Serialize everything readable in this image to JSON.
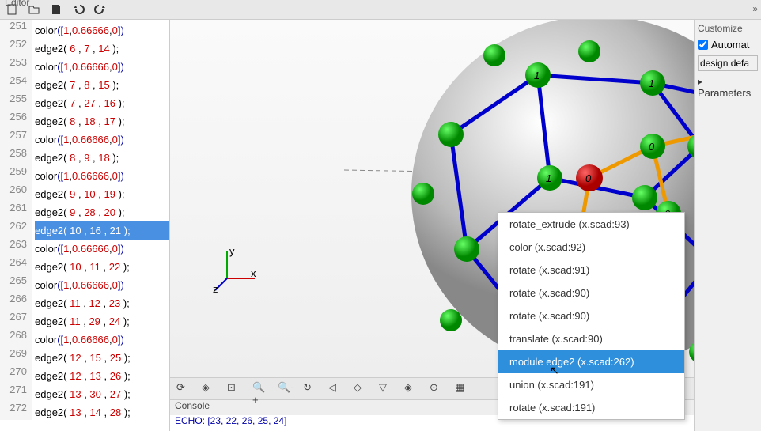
{
  "editor_label": "Editor",
  "toolbar_icons": [
    "new-icon",
    "open-icon",
    "save-icon",
    "undo-icon",
    "redo-icon"
  ],
  "code_lines": [
    {
      "n": "251",
      "sel": false,
      "parts": [
        {
          "t": "color",
          "c": "fn"
        },
        {
          "t": "([",
          "c": "brk"
        },
        {
          "t": "1",
          "c": "num"
        },
        {
          "t": ",",
          "c": ""
        },
        {
          "t": "0.66666",
          "c": "num"
        },
        {
          "t": ",",
          "c": ""
        },
        {
          "t": "0",
          "c": "num"
        },
        {
          "t": "])",
          "c": "brk"
        }
      ]
    },
    {
      "n": "252",
      "sel": false,
      "parts": [
        {
          "t": "edge2",
          "c": "fn"
        },
        {
          "t": "( ",
          "c": ""
        },
        {
          "t": "6",
          "c": "num"
        },
        {
          "t": " , ",
          "c": ""
        },
        {
          "t": "7",
          "c": "num"
        },
        {
          "t": " , ",
          "c": ""
        },
        {
          "t": "14",
          "c": "num"
        },
        {
          "t": " );",
          "c": ""
        }
      ]
    },
    {
      "n": "253",
      "sel": false,
      "parts": [
        {
          "t": "color",
          "c": "fn"
        },
        {
          "t": "([",
          "c": "brk"
        },
        {
          "t": "1",
          "c": "num"
        },
        {
          "t": ",",
          "c": ""
        },
        {
          "t": "0.66666",
          "c": "num"
        },
        {
          "t": ",",
          "c": ""
        },
        {
          "t": "0",
          "c": "num"
        },
        {
          "t": "])",
          "c": "brk"
        }
      ]
    },
    {
      "n": "254",
      "sel": false,
      "parts": [
        {
          "t": "edge2",
          "c": "fn"
        },
        {
          "t": "( ",
          "c": ""
        },
        {
          "t": "7",
          "c": "num"
        },
        {
          "t": " , ",
          "c": ""
        },
        {
          "t": "8",
          "c": "num"
        },
        {
          "t": " , ",
          "c": ""
        },
        {
          "t": "15",
          "c": "num"
        },
        {
          "t": " );",
          "c": ""
        }
      ]
    },
    {
      "n": "255",
      "sel": false,
      "parts": [
        {
          "t": "edge2",
          "c": "fn"
        },
        {
          "t": "( ",
          "c": ""
        },
        {
          "t": "7",
          "c": "num"
        },
        {
          "t": " , ",
          "c": ""
        },
        {
          "t": "27",
          "c": "num"
        },
        {
          "t": " , ",
          "c": ""
        },
        {
          "t": "16",
          "c": "num"
        },
        {
          "t": " );",
          "c": ""
        }
      ]
    },
    {
      "n": "256",
      "sel": false,
      "parts": [
        {
          "t": "edge2",
          "c": "fn"
        },
        {
          "t": "( ",
          "c": ""
        },
        {
          "t": "8",
          "c": "num"
        },
        {
          "t": " , ",
          "c": ""
        },
        {
          "t": "18",
          "c": "num"
        },
        {
          "t": " , ",
          "c": ""
        },
        {
          "t": "17",
          "c": "num"
        },
        {
          "t": " );",
          "c": ""
        }
      ]
    },
    {
      "n": "257",
      "sel": false,
      "parts": [
        {
          "t": "color",
          "c": "fn"
        },
        {
          "t": "([",
          "c": "brk"
        },
        {
          "t": "1",
          "c": "num"
        },
        {
          "t": ",",
          "c": ""
        },
        {
          "t": "0.66666",
          "c": "num"
        },
        {
          "t": ",",
          "c": ""
        },
        {
          "t": "0",
          "c": "num"
        },
        {
          "t": "])",
          "c": "brk"
        }
      ]
    },
    {
      "n": "258",
      "sel": false,
      "parts": [
        {
          "t": "edge2",
          "c": "fn"
        },
        {
          "t": "( ",
          "c": ""
        },
        {
          "t": "8",
          "c": "num"
        },
        {
          "t": " , ",
          "c": ""
        },
        {
          "t": "9",
          "c": "num"
        },
        {
          "t": " , ",
          "c": ""
        },
        {
          "t": "18",
          "c": "num"
        },
        {
          "t": " );",
          "c": ""
        }
      ]
    },
    {
      "n": "259",
      "sel": false,
      "parts": [
        {
          "t": "color",
          "c": "fn"
        },
        {
          "t": "([",
          "c": "brk"
        },
        {
          "t": "1",
          "c": "num"
        },
        {
          "t": ",",
          "c": ""
        },
        {
          "t": "0.66666",
          "c": "num"
        },
        {
          "t": ",",
          "c": ""
        },
        {
          "t": "0",
          "c": "num"
        },
        {
          "t": "])",
          "c": "brk"
        }
      ]
    },
    {
      "n": "260",
      "sel": false,
      "parts": [
        {
          "t": "edge2",
          "c": "fn"
        },
        {
          "t": "( ",
          "c": ""
        },
        {
          "t": "9",
          "c": "num"
        },
        {
          "t": " , ",
          "c": ""
        },
        {
          "t": "10",
          "c": "num"
        },
        {
          "t": " , ",
          "c": ""
        },
        {
          "t": "19",
          "c": "num"
        },
        {
          "t": " );",
          "c": ""
        }
      ]
    },
    {
      "n": "261",
      "sel": false,
      "parts": [
        {
          "t": "edge2",
          "c": "fn"
        },
        {
          "t": "( ",
          "c": ""
        },
        {
          "t": "9",
          "c": "num"
        },
        {
          "t": " , ",
          "c": ""
        },
        {
          "t": "28",
          "c": "num"
        },
        {
          "t": " , ",
          "c": ""
        },
        {
          "t": "20",
          "c": "num"
        },
        {
          "t": " );",
          "c": ""
        }
      ]
    },
    {
      "n": "262",
      "sel": true,
      "parts": [
        {
          "t": "edge2( 10 , 16 , 21 );",
          "c": ""
        }
      ]
    },
    {
      "n": "263",
      "sel": false,
      "parts": [
        {
          "t": "color",
          "c": "fn"
        },
        {
          "t": "([",
          "c": "brk"
        },
        {
          "t": "1",
          "c": "num"
        },
        {
          "t": ",",
          "c": ""
        },
        {
          "t": "0.66666",
          "c": "num"
        },
        {
          "t": ",",
          "c": ""
        },
        {
          "t": "0",
          "c": "num"
        },
        {
          "t": "])",
          "c": "brk"
        }
      ]
    },
    {
      "n": "264",
      "sel": false,
      "parts": [
        {
          "t": "edge2",
          "c": "fn"
        },
        {
          "t": "( ",
          "c": ""
        },
        {
          "t": "10",
          "c": "num"
        },
        {
          "t": " , ",
          "c": ""
        },
        {
          "t": "11",
          "c": "num"
        },
        {
          "t": " , ",
          "c": ""
        },
        {
          "t": "22",
          "c": "num"
        },
        {
          "t": " );",
          "c": ""
        }
      ]
    },
    {
      "n": "265",
      "sel": false,
      "parts": [
        {
          "t": "color",
          "c": "fn"
        },
        {
          "t": "([",
          "c": "brk"
        },
        {
          "t": "1",
          "c": "num"
        },
        {
          "t": ",",
          "c": ""
        },
        {
          "t": "0.66666",
          "c": "num"
        },
        {
          "t": ",",
          "c": ""
        },
        {
          "t": "0",
          "c": "num"
        },
        {
          "t": "])",
          "c": "brk"
        }
      ]
    },
    {
      "n": "266",
      "sel": false,
      "parts": [
        {
          "t": "edge2",
          "c": "fn"
        },
        {
          "t": "( ",
          "c": ""
        },
        {
          "t": "11",
          "c": "num"
        },
        {
          "t": " , ",
          "c": ""
        },
        {
          "t": "12",
          "c": "num"
        },
        {
          "t": " , ",
          "c": ""
        },
        {
          "t": "23",
          "c": "num"
        },
        {
          "t": " );",
          "c": ""
        }
      ]
    },
    {
      "n": "267",
      "sel": false,
      "parts": [
        {
          "t": "edge2",
          "c": "fn"
        },
        {
          "t": "( ",
          "c": ""
        },
        {
          "t": "11",
          "c": "num"
        },
        {
          "t": " , ",
          "c": ""
        },
        {
          "t": "29",
          "c": "num"
        },
        {
          "t": " , ",
          "c": ""
        },
        {
          "t": "24",
          "c": "num"
        },
        {
          "t": " );",
          "c": ""
        }
      ]
    },
    {
      "n": "268",
      "sel": false,
      "parts": [
        {
          "t": "color",
          "c": "fn"
        },
        {
          "t": "([",
          "c": "brk"
        },
        {
          "t": "1",
          "c": "num"
        },
        {
          "t": ",",
          "c": ""
        },
        {
          "t": "0.66666",
          "c": "num"
        },
        {
          "t": ",",
          "c": ""
        },
        {
          "t": "0",
          "c": "num"
        },
        {
          "t": "])",
          "c": "brk"
        }
      ]
    },
    {
      "n": "269",
      "sel": false,
      "parts": [
        {
          "t": "edge2",
          "c": "fn"
        },
        {
          "t": "( ",
          "c": ""
        },
        {
          "t": "12",
          "c": "num"
        },
        {
          "t": " , ",
          "c": ""
        },
        {
          "t": "15",
          "c": "num"
        },
        {
          "t": " , ",
          "c": ""
        },
        {
          "t": "25",
          "c": "num"
        },
        {
          "t": " );",
          "c": ""
        }
      ]
    },
    {
      "n": "270",
      "sel": false,
      "parts": [
        {
          "t": "edge2",
          "c": "fn"
        },
        {
          "t": "( ",
          "c": ""
        },
        {
          "t": "12",
          "c": "num"
        },
        {
          "t": " , ",
          "c": ""
        },
        {
          "t": "13",
          "c": "num"
        },
        {
          "t": " , ",
          "c": ""
        },
        {
          "t": "26",
          "c": "num"
        },
        {
          "t": " );",
          "c": ""
        }
      ]
    },
    {
      "n": "271",
      "sel": false,
      "parts": [
        {
          "t": "edge2",
          "c": "fn"
        },
        {
          "t": "( ",
          "c": ""
        },
        {
          "t": "13",
          "c": "num"
        },
        {
          "t": " , ",
          "c": ""
        },
        {
          "t": "30",
          "c": "num"
        },
        {
          "t": " , ",
          "c": ""
        },
        {
          "t": "27",
          "c": "num"
        },
        {
          "t": " );",
          "c": ""
        }
      ]
    },
    {
      "n": "272",
      "sel": false,
      "parts": [
        {
          "t": "edge2",
          "c": "fn"
        },
        {
          "t": "( ",
          "c": ""
        },
        {
          "t": "13",
          "c": "num"
        },
        {
          "t": " , ",
          "c": ""
        },
        {
          "t": "14",
          "c": "num"
        },
        {
          "t": " , ",
          "c": ""
        },
        {
          "t": "28",
          "c": "num"
        },
        {
          "t": " );",
          "c": ""
        }
      ]
    }
  ],
  "context_menu": [
    {
      "label": "rotate_extrude (x.scad:93)",
      "hl": false
    },
    {
      "label": "color (x.scad:92)",
      "hl": false
    },
    {
      "label": "rotate (x.scad:91)",
      "hl": false
    },
    {
      "label": "rotate (x.scad:90)",
      "hl": false
    },
    {
      "label": "rotate (x.scad:90)",
      "hl": false
    },
    {
      "label": "translate (x.scad:90)",
      "hl": false
    },
    {
      "label": "module edge2 (x.scad:262)",
      "hl": true
    },
    {
      "label": "union (x.scad:191)",
      "hl": false
    },
    {
      "label": "rotate (x.scad:191)",
      "hl": false
    }
  ],
  "console_label": "Console",
  "console_line": "ECHO: [23, 22, 26, 25, 24]",
  "right": {
    "panel_label": "Customize",
    "auto_label": "Automat",
    "select": "design defa",
    "params": "Parameters"
  },
  "axes": {
    "x": "x",
    "y": "y",
    "z": "z"
  }
}
